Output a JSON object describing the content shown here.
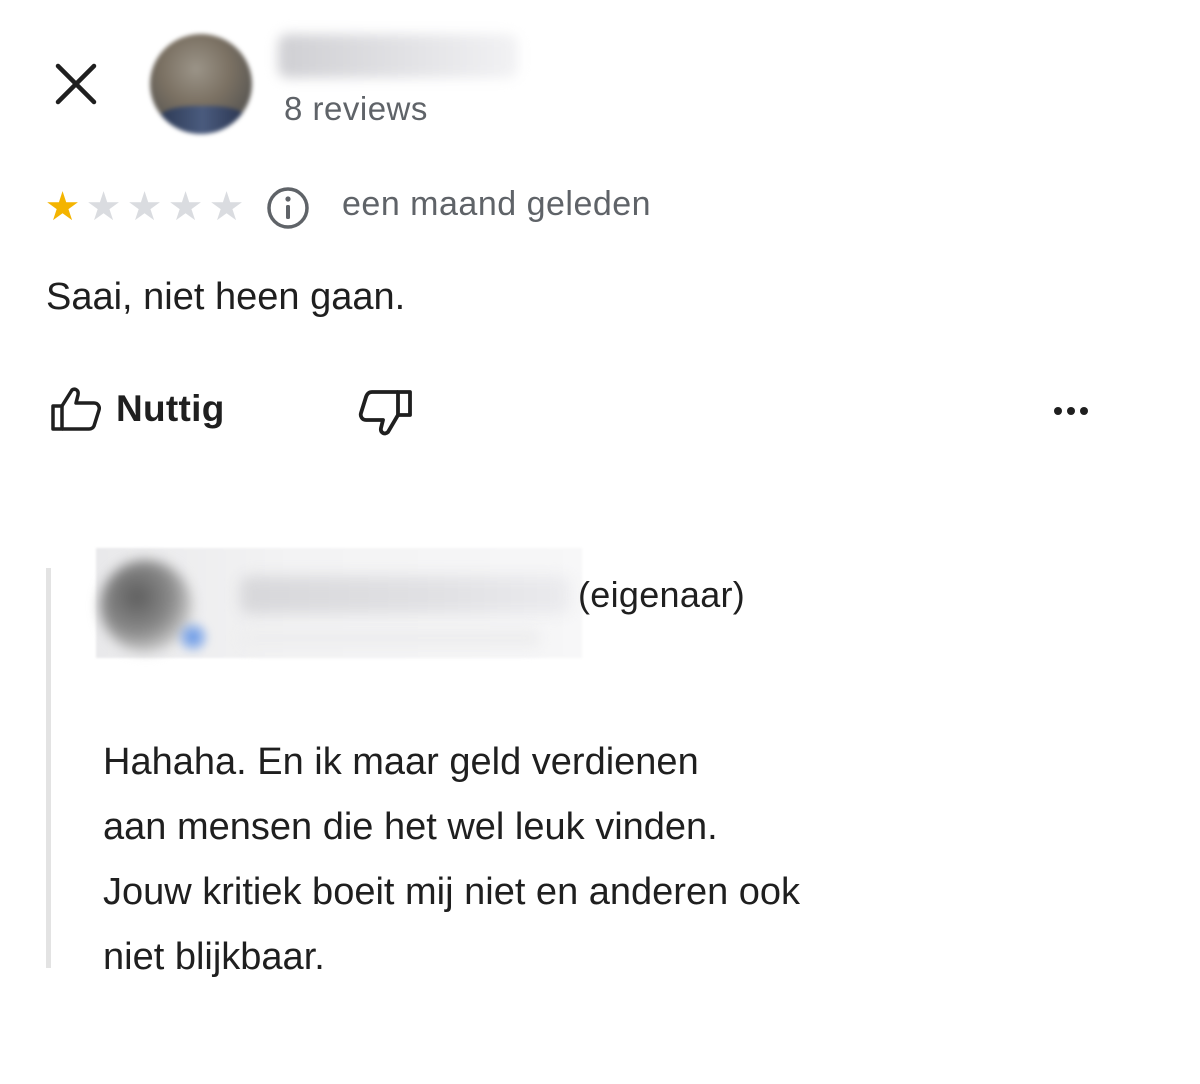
{
  "review": {
    "reviewer_reviews_count": "8 reviews",
    "rating": 1,
    "max_rating": 5,
    "time_ago": "een maand geleden",
    "text": "Saai, niet heen gaan.",
    "helpful_label": "Nuttig"
  },
  "reply": {
    "owner_label": "(eigenaar)",
    "lines": [
      "Hahaha. En ik maar geld verdienen",
      "aan mensen die het wel leuk vinden.",
      "Jouw kritiek boeit mij niet en anderen ook",
      "niet blijkbaar."
    ]
  },
  "icons": {
    "close": "close-icon",
    "info": "info-icon",
    "thumbs_up": "thumbs-up-icon",
    "thumbs_down": "thumbs-down-icon",
    "more": "more-horizontal-icon"
  },
  "colors": {
    "star_filled": "#f4b400",
    "star_empty": "#dadce0",
    "secondary_text": "#5f6368",
    "primary_text": "#1f1f1f",
    "reply_border": "#e3e3e3"
  }
}
